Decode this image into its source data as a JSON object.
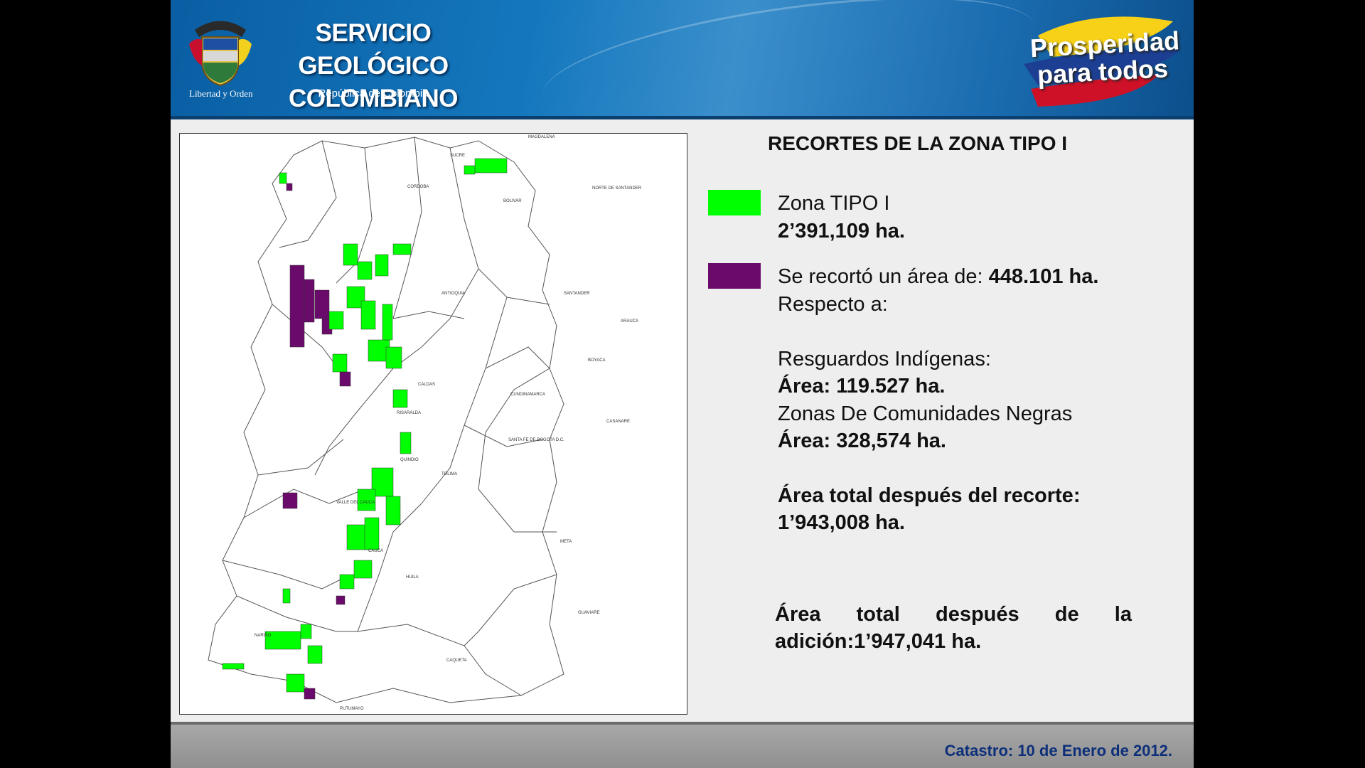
{
  "header": {
    "org_line1": "SERVICIO GEOLÓGICO",
    "org_line2": "COLOMBIANO",
    "republic": "República de Colombia",
    "motto": "Libertad y Orden",
    "slogan_line1": "Prosperidad",
    "slogan_line2": "para todos"
  },
  "map": {
    "labels": [
      "MAGDALENA",
      "SUCRE",
      "CORDOBA",
      "BOLIVAR",
      "NORTE DE SANTANDER",
      "SANTANDER",
      "ARAUCA",
      "BOYACA",
      "ANTIOQUIA",
      "CALDAS",
      "CUNDINAMARCA",
      "CASANARE",
      "RISARALDA",
      "QUINDIO",
      "SANTA FE DE BOGOTA D.C.",
      "TOLIMA",
      "VALLE DEL CAUCA",
      "META",
      "HUILA",
      "CAUCA",
      "GUAVIARE",
      "NARIÑO",
      "CAQUETA",
      "PUTUMAYO"
    ]
  },
  "title": "RECORTES DE LA ZONA TIPO I",
  "legend": {
    "zona_label": "Zona TIPO I",
    "zona_area": "2’391,109 ha.",
    "recorte_prefix": "Se recortó un área de: ",
    "recorte_value": "448.101 ha.",
    "respecto": "Respecto a:"
  },
  "details": {
    "resguardos_label": "Resguardos Indígenas:",
    "resguardos_area": "Área: 119.527 ha.",
    "comunidades_label": "Zonas De Comunidades Negras",
    "comunidades_area": "Área: 328,574 ha.",
    "total_recorte_label": "Área total después del recorte:",
    "total_recorte_value": "1’943,008 ha.",
    "total_adicion": "Área total después de la adición:1’947,041 ha."
  },
  "footer": {
    "text": "Catastro: 10 de Enero de 2012."
  },
  "colors": {
    "zona": "#00ff00",
    "recorte": "#6a0a6a",
    "header": "#1477bd",
    "footer_text": "#0d2f7a"
  }
}
